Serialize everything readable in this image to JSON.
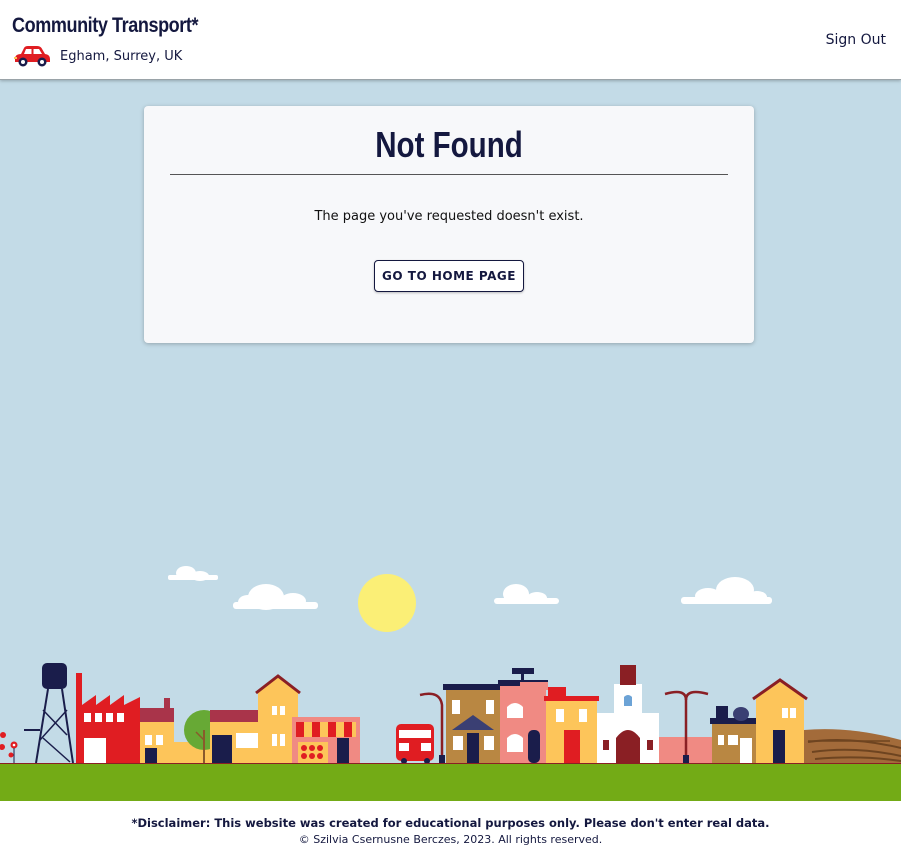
{
  "header": {
    "brand": "Community Transport*",
    "location_icon": "car-icon",
    "location": "Egham, Surrey, UK",
    "signout_label": "Sign Out"
  },
  "card": {
    "title": "Not Found",
    "message": "The page you've requested doesn't exist.",
    "button_label": "GO TO HOME PAGE"
  },
  "scene": {
    "sky_color": "#c3dbe7",
    "grass_color": "#73ab16",
    "sun_color": "#fbef76",
    "accent_red": "#e01d22",
    "accent_yellow": "#fdc55a",
    "navy": "#1a1d4b"
  },
  "footer": {
    "disclaimer": "*Disclaimer: This website was created for educational purposes only. Please don't enter real data.",
    "copyright": "© Szilvia Csernusne Berczes, 2023. All rights reserved."
  }
}
